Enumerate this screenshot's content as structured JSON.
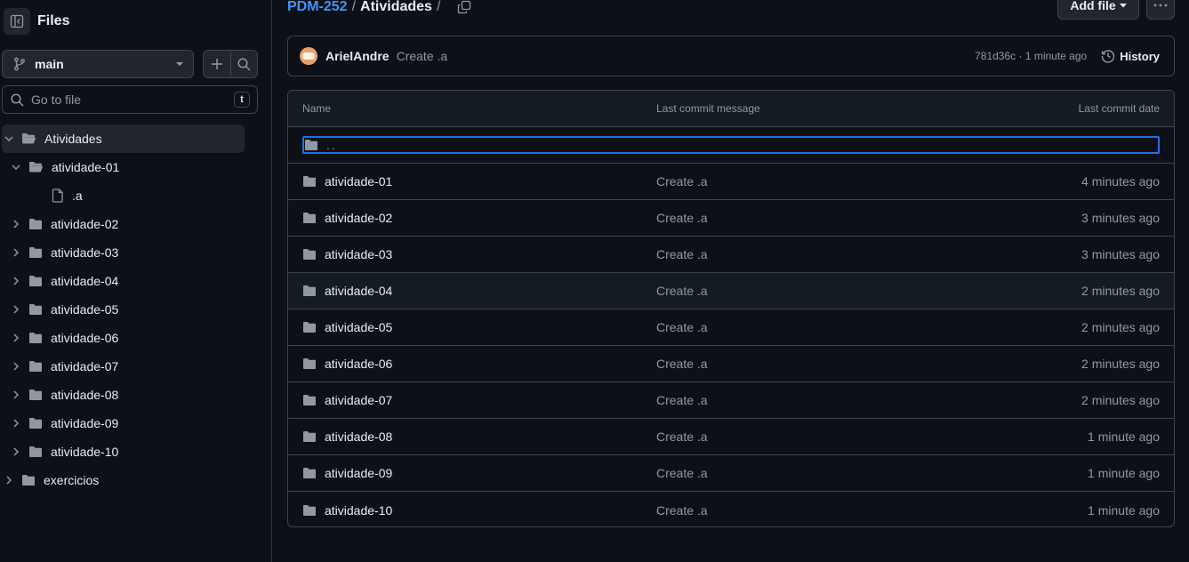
{
  "sidebar": {
    "title": "Files",
    "branch": "main",
    "search_placeholder": "Go to file",
    "search_shortcut": "t",
    "tree": [
      {
        "label": "Atividades",
        "level": 0,
        "expanded": true,
        "selected": true,
        "type": "folder"
      },
      {
        "label": "atividade-01",
        "level": 1,
        "expanded": true,
        "type": "folder"
      },
      {
        "label": ".a",
        "level": 2,
        "type": "file"
      },
      {
        "label": "atividade-02",
        "level": 1,
        "expanded": false,
        "type": "folder"
      },
      {
        "label": "atividade-03",
        "level": 1,
        "expanded": false,
        "type": "folder"
      },
      {
        "label": "atividade-04",
        "level": 1,
        "expanded": false,
        "type": "folder"
      },
      {
        "label": "atividade-05",
        "level": 1,
        "expanded": false,
        "type": "folder"
      },
      {
        "label": "atividade-06",
        "level": 1,
        "expanded": false,
        "type": "folder"
      },
      {
        "label": "atividade-07",
        "level": 1,
        "expanded": false,
        "type": "folder"
      },
      {
        "label": "atividade-08",
        "level": 1,
        "expanded": false,
        "type": "folder"
      },
      {
        "label": "atividade-09",
        "level": 1,
        "expanded": false,
        "type": "folder"
      },
      {
        "label": "atividade-10",
        "level": 1,
        "expanded": false,
        "type": "folder"
      },
      {
        "label": "exercicios",
        "level": 0,
        "expanded": false,
        "type": "folder"
      }
    ]
  },
  "breadcrumb": {
    "repo": "PDM-252",
    "separator": "/",
    "dir": "Atividades"
  },
  "actions": {
    "add_file": "Add file"
  },
  "commit": {
    "author": "ArielAndre",
    "message": "Create .a",
    "meta": "781d36c · 1 minute ago",
    "history": "History"
  },
  "table": {
    "headers": [
      "Name",
      "Last commit message",
      "Last commit date"
    ],
    "parent": "..",
    "rows": [
      {
        "name": "atividade-01",
        "message": "Create .a",
        "date": "4 minutes ago"
      },
      {
        "name": "atividade-02",
        "message": "Create .a",
        "date": "3 minutes ago"
      },
      {
        "name": "atividade-03",
        "message": "Create .a",
        "date": "3 minutes ago"
      },
      {
        "name": "atividade-04",
        "message": "Create .a",
        "date": "2 minutes ago",
        "hover": true
      },
      {
        "name": "atividade-05",
        "message": "Create .a",
        "date": "2 minutes ago"
      },
      {
        "name": "atividade-06",
        "message": "Create .a",
        "date": "2 minutes ago"
      },
      {
        "name": "atividade-07",
        "message": "Create .a",
        "date": "2 minutes ago"
      },
      {
        "name": "atividade-08",
        "message": "Create .a",
        "date": "1 minute ago"
      },
      {
        "name": "atividade-09",
        "message": "Create .a",
        "date": "1 minute ago"
      },
      {
        "name": "atividade-10",
        "message": "Create .a",
        "date": "1 minute ago"
      }
    ]
  },
  "colors": {
    "background": "#0d1117",
    "link": "#4493f8",
    "folder_icon": "#9198a1",
    "focus": "#1f6feb"
  }
}
